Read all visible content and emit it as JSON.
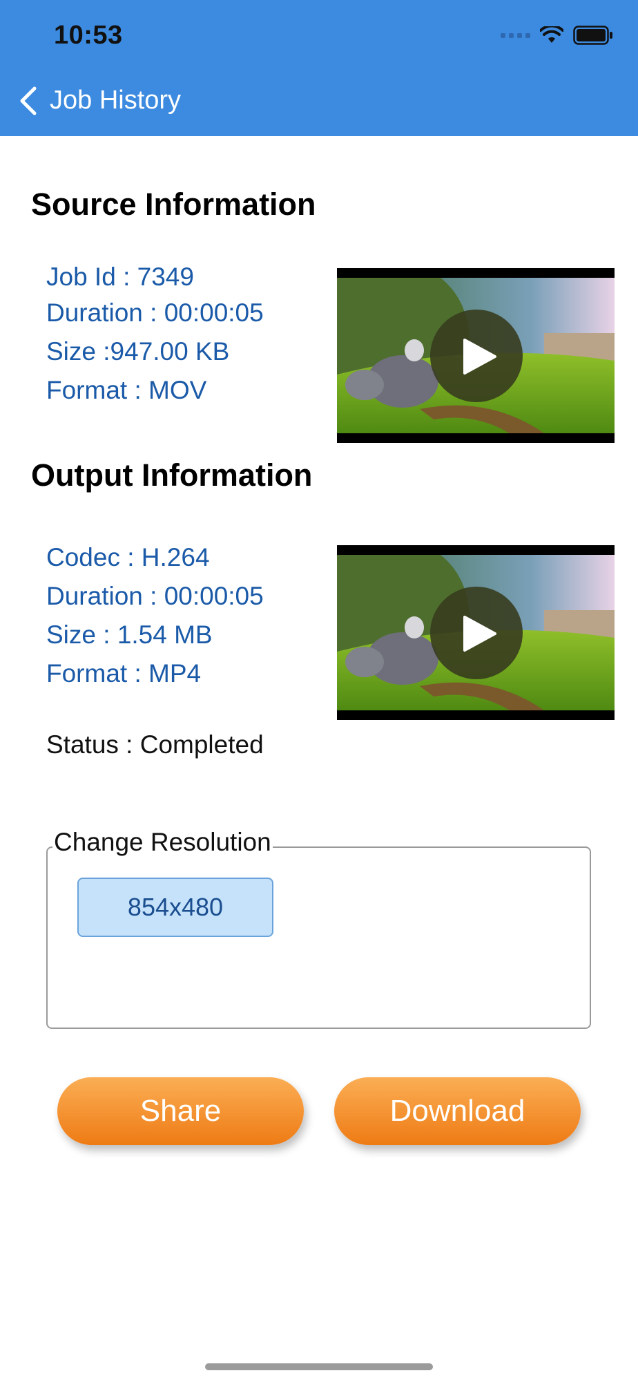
{
  "status_bar": {
    "time": "10:53"
  },
  "nav": {
    "title": "Job History",
    "back_icon": "chevron-left-icon"
  },
  "source": {
    "title": "Source Information",
    "job_id": "Job Id : 7349",
    "duration": "Duration : 00:00:05",
    "size": "Size :947.00 KB",
    "format": "Format : MOV"
  },
  "output": {
    "title": "Output Information",
    "codec": "Codec : H.264",
    "duration": "Duration : 00:00:05",
    "size": "Size : 1.54 MB",
    "format": "Format : MP4",
    "status": "Status : Completed"
  },
  "resolution": {
    "legend": "Change Resolution",
    "option": "854x480"
  },
  "actions": {
    "share": "Share",
    "download": "Download"
  },
  "colors": {
    "header": "#3d8be0",
    "info_text": "#1a5aa8",
    "button_orange": "#f28a24",
    "resolution_bg": "#c6e2fb"
  }
}
